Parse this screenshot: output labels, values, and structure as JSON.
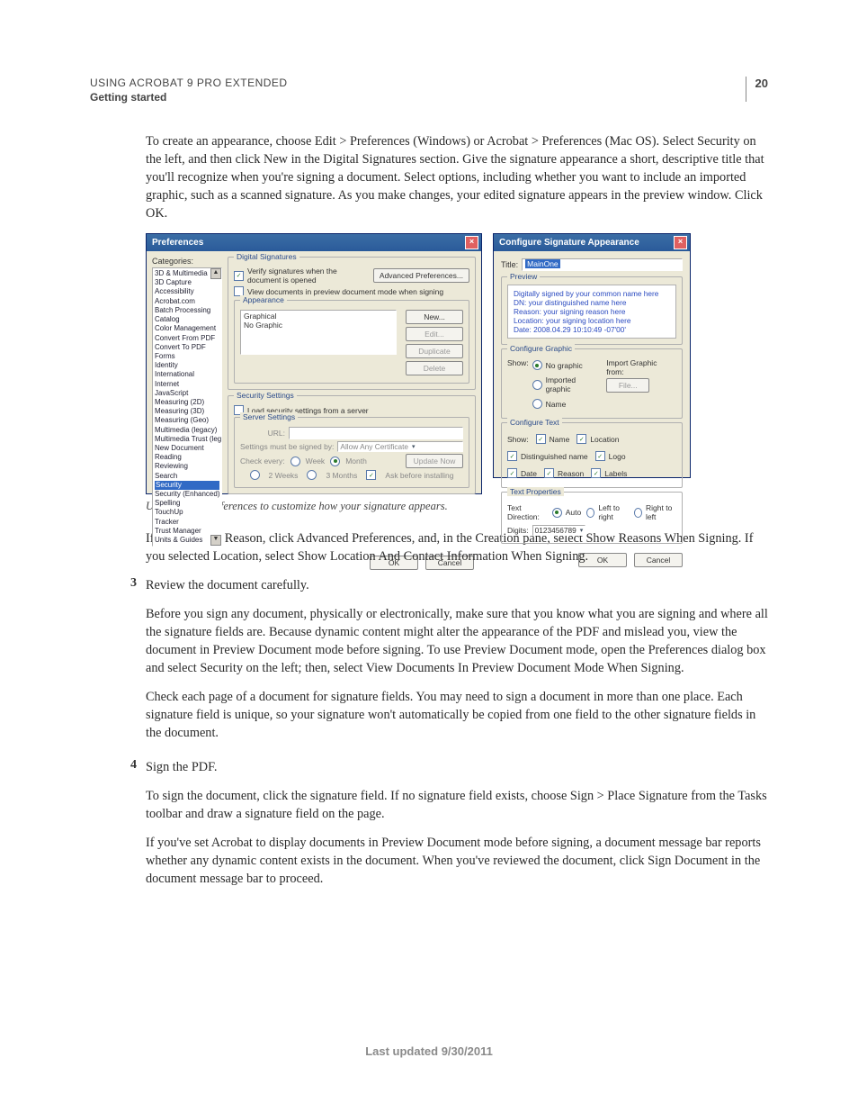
{
  "header": {
    "line1": "USING ACROBAT 9 PRO EXTENDED",
    "line2": "Getting started",
    "page_number": "20"
  },
  "intro_para": "To create an appearance, choose Edit > Preferences (Windows) or Acrobat > Preferences (Mac OS). Select Security on the left, and then click New in the Digital Signatures section. Give the signature appearance a short, descriptive title that you'll recognize when you're signing a document. Select options, including whether you want to include an imported graphic, such as a scanned signature. As you make changes, your edited signature appears in the preview window. Click OK.",
  "prefs_dialog": {
    "title": "Preferences",
    "categories_label": "Categories:",
    "categories": [
      "3D & Multimedia",
      "3D Capture",
      "Accessibility",
      "Acrobat.com",
      "Batch Processing",
      "Catalog",
      "Color Management",
      "Convert From PDF",
      "Convert To PDF",
      "Forms",
      "Identity",
      "International",
      "Internet",
      "JavaScript",
      "Measuring (2D)",
      "Measuring (3D)",
      "Measuring (Geo)",
      "Multimedia (legacy)",
      "Multimedia Trust (legacy)",
      "New Document",
      "Reading",
      "Reviewing",
      "Search",
      "Security",
      "Security (Enhanced)",
      "Spelling",
      "TouchUp",
      "Tracker",
      "Trust Manager",
      "Units & Guides"
    ],
    "selected_category": "Security",
    "digsig_group": "Digital Signatures",
    "verify_chk": "Verify signatures when the document is opened",
    "viewdocs_chk": "View documents in preview document mode when signing",
    "adv_prefs_btn": "Advanced Preferences...",
    "appearance_group": "Appearance",
    "appearance_items": [
      "Graphical",
      "No Graphic"
    ],
    "new_btn": "New...",
    "edit_btn": "Edit...",
    "dup_btn": "Duplicate",
    "del_btn": "Delete",
    "secset_group": "Security Settings",
    "load_chk": "Load security settings from a server",
    "server_group": "Server Settings",
    "url_label": "URL:",
    "signedby_label": "Settings must be signed by:",
    "signedby_value": "Allow Any Certificate",
    "check_label": "Check every:",
    "check_opts": [
      "Week",
      "Month",
      "2 Weeks",
      "3 Months",
      "Ask before installing"
    ],
    "update_btn": "Update Now",
    "ok_btn": "OK",
    "cancel_btn": "Cancel"
  },
  "config_dialog": {
    "title": "Configure Signature Appearance",
    "title_label": "Title:",
    "title_value": "MainOne",
    "preview_group": "Preview",
    "preview_lines": [
      "Digitally signed by your common name here",
      "DN: your distinguished name here",
      "Reason: your signing reason here",
      "Location: your signing location here",
      "Date: 2008.04.29 10:10:49 -07'00'"
    ],
    "cfg_graphic_group": "Configure Graphic",
    "show_label": "Show:",
    "no_graphic": "No graphic",
    "imported_graphic": "Imported graphic",
    "name_opt": "Name",
    "import_from": "Import Graphic from:",
    "file_btn": "File...",
    "cfg_text_group": "Configure Text",
    "text_opts": [
      "Name",
      "Location",
      "Distinguished name",
      "Logo",
      "Date",
      "Reason",
      "Labels"
    ],
    "text_props_group": "Text Properties",
    "text_dir_label": "Text Direction:",
    "dir_opts": [
      "Auto",
      "Left to right",
      "Right to left"
    ],
    "digits_label": "Digits:",
    "digits_value": "0123456789",
    "ok_btn": "OK",
    "cancel_btn": "Cancel"
  },
  "caption": "Use Security preferences to customize how your signature appears.",
  "after_fig_para": "If you selected Reason, click Advanced Preferences, and, in the Creation pane, select Show Reasons When Signing. If you selected Location, select Show Location And Contact Information When Signing.",
  "steps": {
    "s3": {
      "num": "3",
      "title": "Review the document carefully.",
      "p1": "Before you sign any document, physically or electronically, make sure that you know what you are signing and where all the signature fields are. Because dynamic content might alter the appearance of the PDF and mislead you, view the document in Preview Document mode before signing. To use Preview Document mode, open the Preferences dialog box and select Security on the left; then, select View Documents In Preview Document Mode When Signing.",
      "p2": "Check each page of a document for signature fields. You may need to sign a document in more than one place. Each signature field is unique, so your signature won't automatically be copied from one field to the other signature fields in the document."
    },
    "s4": {
      "num": "4",
      "title": "Sign the PDF.",
      "p1": "To sign the document, click the signature field. If no signature field exists, choose Sign > Place Signature from the Tasks toolbar and draw a signature field on the page.",
      "p2": "If you've set Acrobat to display documents in Preview Document mode before signing, a document message bar reports whether any dynamic content exists in the document. When you've reviewed the document, click Sign Document in the document message bar to proceed."
    }
  },
  "footer_date": "Last updated 9/30/2011"
}
